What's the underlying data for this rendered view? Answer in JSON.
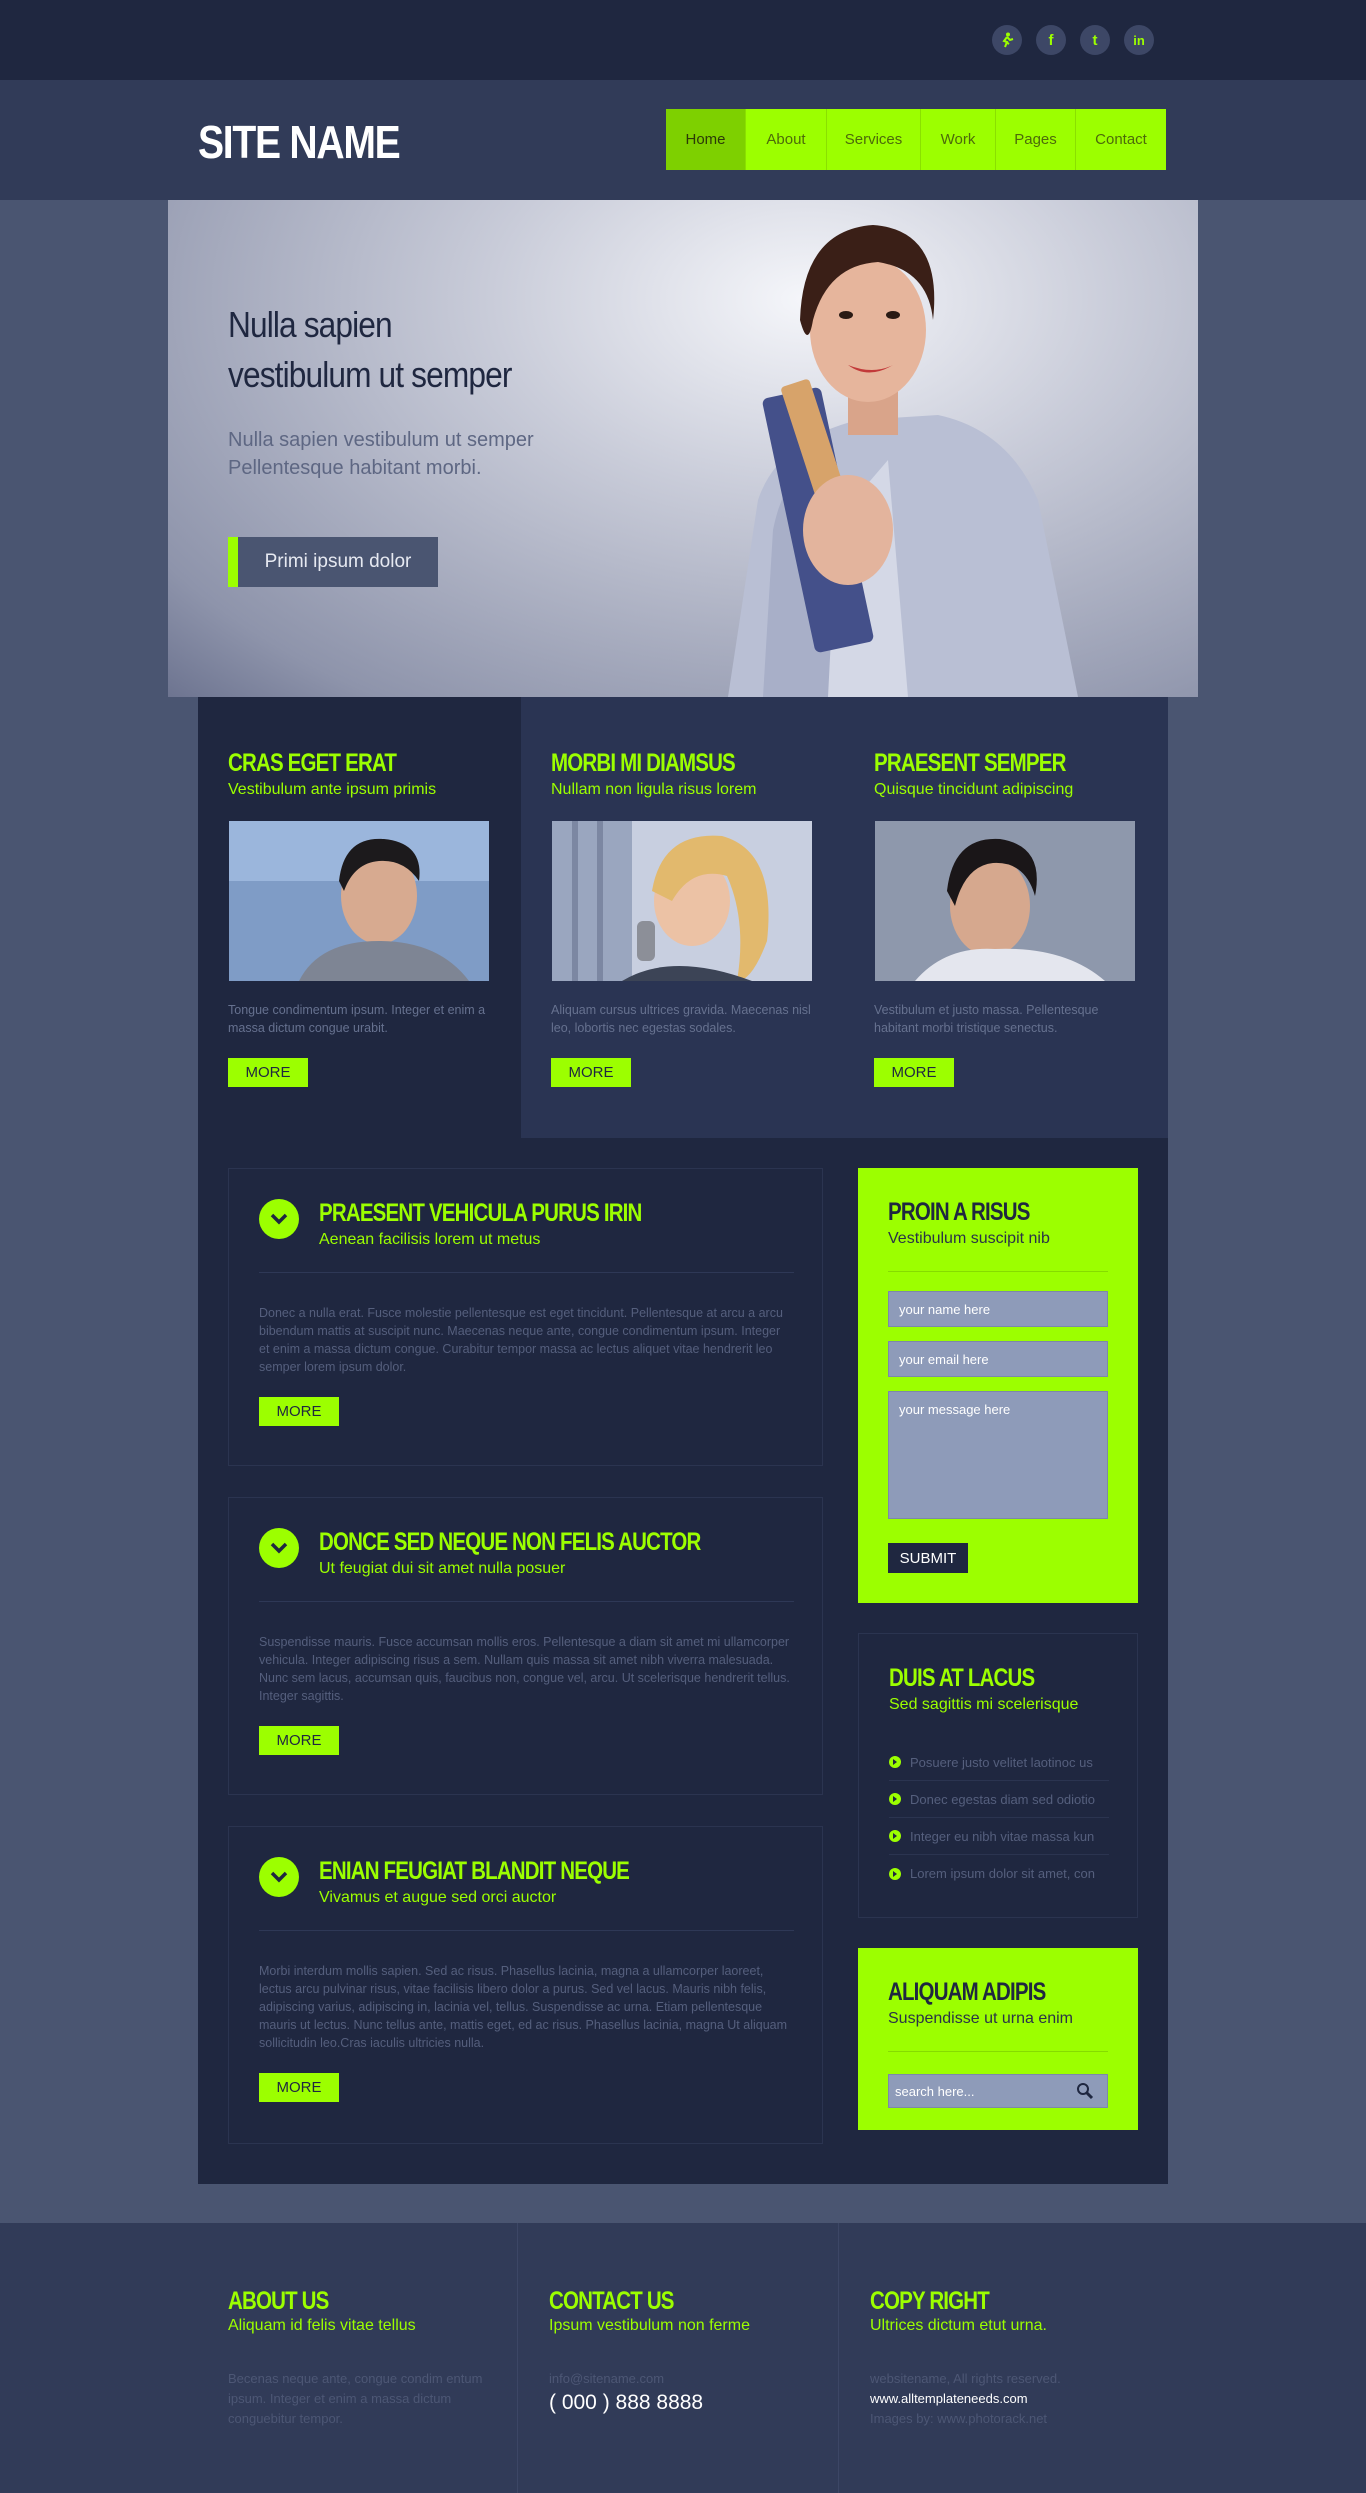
{
  "social": [
    {
      "name": "runner",
      "glyph": "✦"
    },
    {
      "name": "facebook",
      "glyph": "f"
    },
    {
      "name": "twitter",
      "glyph": "t"
    },
    {
      "name": "linkedin",
      "glyph": "in"
    }
  ],
  "header": {
    "site_name": "SITE NAME",
    "nav": [
      "Home",
      "About",
      "Services",
      "Work",
      "Pages",
      "Contact"
    ]
  },
  "hero": {
    "title_line1": "Nulla sapien",
    "title_line2": "vestibulum ut semper",
    "subtitle_line1": "Nulla sapien vestibulum ut semper",
    "subtitle_line2": "Pellentesque habitant morbi.",
    "button": "Primi ipsum dolor"
  },
  "features": [
    {
      "title": "CRAS EGET ERAT",
      "subtitle": "Vestibulum ante ipsum primis",
      "text": "Tongue condimentum ipsum. Integer et enim a massa dictum congue urabit.",
      "more": "MORE"
    },
    {
      "title": "MORBI MI DIAMSUS",
      "subtitle": "Nullam non ligula risus lorem",
      "text": "Aliquam cursus ultrices gravida. Maecenas nisl leo, lobortis nec egestas sodales.",
      "more": "MORE"
    },
    {
      "title": "PRAESENT SEMPER",
      "subtitle": "Quisque tincidunt adipiscing",
      "text": "Vestibulum et justo massa. Pellentesque habitant morbi tristique senectus.",
      "more": "MORE"
    }
  ],
  "posts": [
    {
      "title": "PRAESENT VEHICULA PURUS IRIN",
      "subtitle": "Aenean facilisis lorem ut metus",
      "text": "Donec a nulla erat. Fusce molestie pellentesque est eget tincidunt. Pellentesque at arcu a arcu bibendum mattis at suscipit nunc. Maecenas neque ante, congue condimentum ipsum. Integer et enim a massa dictum congue. Curabitur tempor massa ac lectus aliquet vitae hendrerit leo semper lorem ipsum dolor.",
      "more": "MORE"
    },
    {
      "title": "DONCE SED NEQUE NON FELIS AUCTOR",
      "subtitle": "Ut feugiat dui sit amet nulla posuer",
      "text": "Suspendisse mauris. Fusce accumsan mollis eros. Pellentesque a diam sit amet mi ullamcorper vehicula. Integer adipiscing risus a sem. Nullam quis massa sit amet nibh viverra malesuada. Nunc sem lacus, accumsan quis, faucibus non, congue vel, arcu. Ut scelerisque hendrerit tellus. Integer sagittis.",
      "more": "MORE"
    },
    {
      "title": "ENIAN FEUGIAT BLANDIT NEQUE",
      "subtitle": "Vivamus et augue sed orci auctor",
      "text": "Morbi interdum mollis sapien. Sed ac risus. Phasellus lacinia, magna a ullamcorper laoreet, lectus arcu pulvinar risus, vitae facilisis libero dolor a purus. Sed vel lacus. Mauris nibh felis, adipiscing varius, adipiscing in, lacinia vel, tellus. Suspendisse ac urna. Etiam pellentesque mauris ut lectus. Nunc tellus ante, mattis eget, ed ac risus. Phasellus lacinia, magna Ut aliquam sollicitudin leo.Cras iaculis ultricies nulla.",
      "more": "MORE"
    }
  ],
  "contact": {
    "title": "PROIN A RISUS",
    "subtitle": "Vestibulum suscipit nib",
    "name_placeholder": "your name here",
    "email_placeholder": "your email  here",
    "message_placeholder": "your message  here",
    "submit": "SUBMIT"
  },
  "links": {
    "title": "DUIS AT LACUS",
    "subtitle": "Sed sagittis mi scelerisque",
    "items": [
      "Posuere justo velitet laotinoc us",
      "Donec egestas diam sed odiotio",
      "Integer eu nibh vitae massa kun",
      "Lorem ipsum dolor sit amet, con"
    ]
  },
  "search": {
    "title": "ALIQUAM ADIPIS",
    "subtitle": "Suspendisse ut urna enim",
    "placeholder": "search here..."
  },
  "footer": {
    "about": {
      "title": "ABOUT US",
      "subtitle": "Aliquam id felis vitae tellus",
      "line1": "Becenas neque ante, congue condim entum",
      "line2": "ipsum. Integer et enim a massa dictum",
      "line3": "conguebitur tempor."
    },
    "contact": {
      "title": "CONTACT US",
      "subtitle": "Ipsum vestibulum non ferme",
      "email": "info@sitename.com",
      "phone": "( 000 ) 888 8888"
    },
    "copyright": {
      "title": "COPY RIGHT",
      "subtitle": "Ultrices dictum etut urna.",
      "line1": "websitename, All rights reserved.",
      "link": "www.alltemplateneeds.com",
      "line3": "Images by: www.photorack.net"
    }
  },
  "colors": {
    "accent": "#9cff00",
    "dark": "#1f2740",
    "mid": "#313b58",
    "bg": "#4a5571"
  }
}
